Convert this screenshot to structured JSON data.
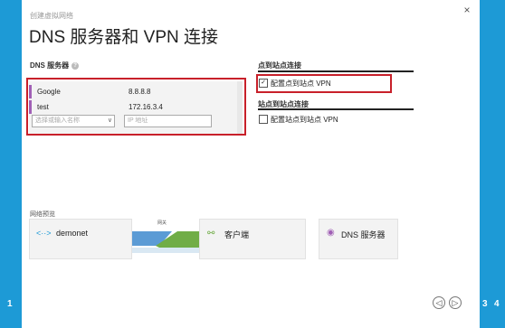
{
  "wizard": {
    "subtitle": "创建虚拟网络",
    "title": "DNS 服务器和 VPN 连接",
    "steps": [
      "1",
      "3",
      "4"
    ],
    "close_label": "×"
  },
  "dns": {
    "section_label": "DNS 服务器",
    "help_label": "?",
    "servers": [
      {
        "name": "Google",
        "ip": "8.8.8.8"
      },
      {
        "name": "test",
        "ip": "172.16.3.4"
      }
    ],
    "name_placeholder": "选择或输入名称",
    "ip_placeholder": "IP 地址"
  },
  "p2s": {
    "section_label": "点到站点连接",
    "checkbox_label": "配置点到站点 VPN",
    "checked": true
  },
  "s2s": {
    "section_label": "站点到站点连接",
    "checkbox_label": "配置站点到站点 VPN",
    "checked": false
  },
  "preview": {
    "section_label": "网络预览",
    "network_name": "demonet",
    "gateway_label": "网关",
    "clients_label": "客户端",
    "dns_label": "DNS 服务器"
  },
  "nav": {
    "back_icon": "◁",
    "next_icon": "▷"
  },
  "colors": {
    "rail_blue": "#1d9ad6",
    "highlight_red": "#c8202a",
    "dns_accent": "#a05fb5",
    "gateway_blue": "#5b9bd5",
    "gateway_green": "#70ad47"
  }
}
